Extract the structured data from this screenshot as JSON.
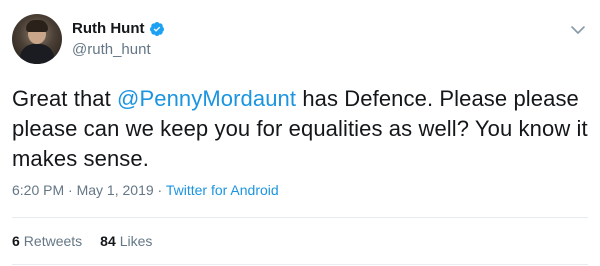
{
  "author": {
    "display_name": "Ruth Hunt",
    "handle": "@ruth_hunt",
    "verified_icon": "verified-badge-icon",
    "verified_color": "#1da1f2"
  },
  "tweet": {
    "text_before": "Great that ",
    "mention": "@PennyMordaunt",
    "text_after": " has Defence. Please please please can we keep you for equalities as well? You know it makes sense."
  },
  "meta": {
    "time": "6:20 PM",
    "separator1": " · ",
    "date": "May 1, 2019",
    "separator2": " · ",
    "source": "Twitter for Android"
  },
  "stats": {
    "retweets_count": "6",
    "retweets_label": "Retweets",
    "likes_count": "84",
    "likes_label": "Likes"
  },
  "colors": {
    "link": "#1b95e0",
    "secondary_text": "#657786",
    "primary_text": "#14171a",
    "divider": "#e6ecf0"
  },
  "icons": {
    "menu_caret": "chevron-down-icon"
  }
}
